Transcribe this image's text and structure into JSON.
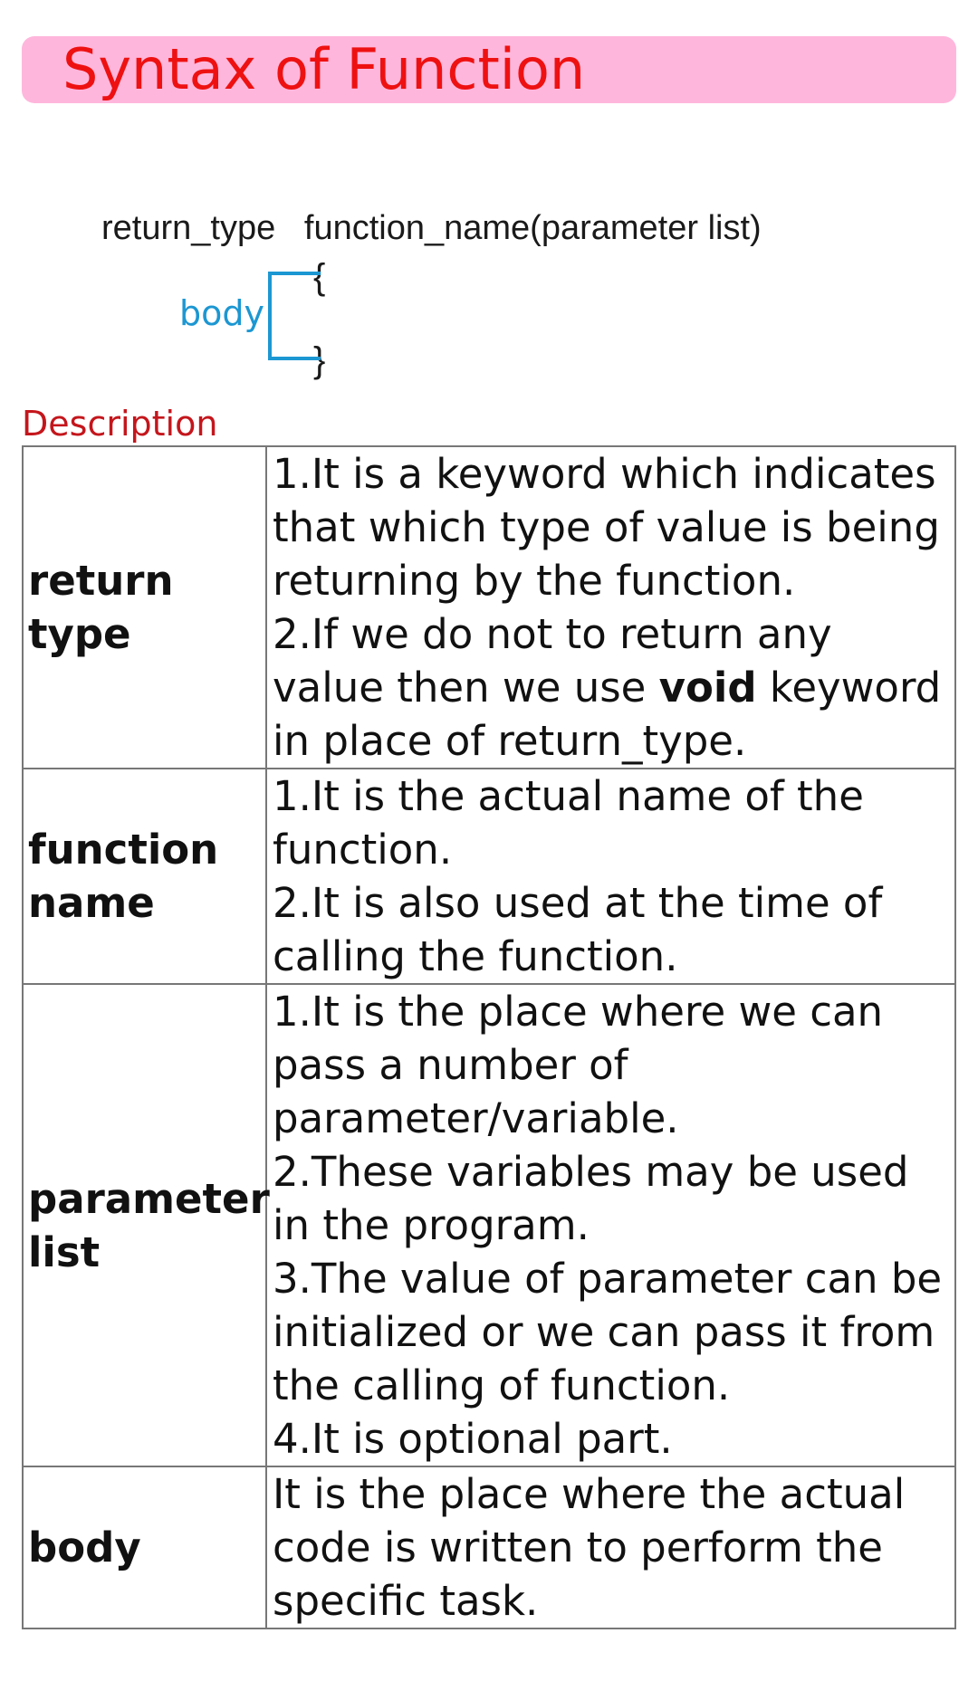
{
  "title": "Syntax of Function",
  "syntax": {
    "signature": "return_type   function_name(parameter list)",
    "open_brace": "{",
    "close_brace": "}",
    "body_label": "body"
  },
  "description_label": "Description",
  "rows": [
    {
      "term": "return type",
      "lines": [
        "1.It is a keyword which indicates that which type of value is being returning by the function.",
        "2.If we do not to return any value then we use",
        "void",
        "keyword in place of return_type."
      ]
    },
    {
      "term": "function name",
      "lines": [
        "1.It is the actual name of the function.",
        "2.It is also used at the time of calling the function."
      ]
    },
    {
      "term": "parameter list",
      "lines": [
        "1.It is the place where we can pass a number of parameter/variable.",
        "2.These variables may be used in the program.",
        "3.The value of parameter can be initialized or we can pass it from the calling of function.",
        "4.It is optional part."
      ]
    },
    {
      "term": "body",
      "lines": [
        "It is the place where the actual code is written to perform the specific task."
      ]
    }
  ],
  "colors": {
    "title_bg": "#ffb6dc",
    "title_text": "#ee1111",
    "body_label": "#1c97d2",
    "description_label": "#c4161c"
  }
}
